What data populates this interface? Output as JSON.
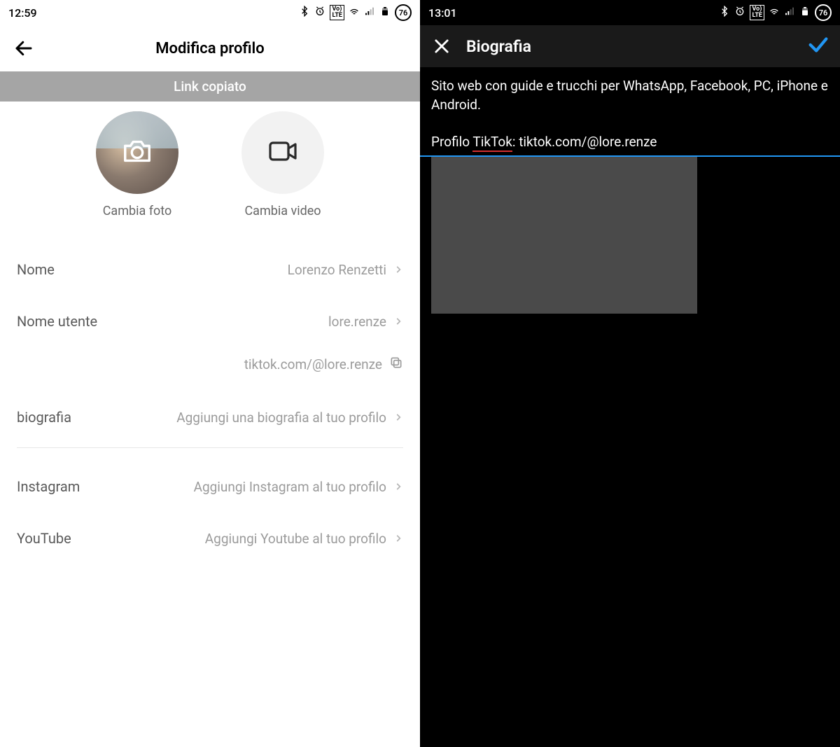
{
  "left": {
    "status": {
      "time": "12:59",
      "battery": "76"
    },
    "appbar": {
      "title": "Modifica profilo"
    },
    "toast": "Link copiato",
    "media": {
      "photo_label": "Cambia foto",
      "video_label": "Cambia video"
    },
    "fields": {
      "name_label": "Nome",
      "name_value": "Lorenzo Renzetti",
      "username_label": "Nome utente",
      "username_value": "lore.renze",
      "profile_link": "tiktok.com/@lore.renze",
      "bio_label": "biografia",
      "bio_placeholder": "Aggiungi una biografia al tuo profilo",
      "instagram_label": "Instagram",
      "instagram_placeholder": "Aggiungi Instagram al tuo profilo",
      "youtube_label": "YouTube",
      "youtube_placeholder": "Aggiungi Youtube al tuo profilo"
    }
  },
  "right": {
    "status": {
      "time": "13:01",
      "battery": "76"
    },
    "appbar": {
      "title": "Biografia"
    },
    "bio": {
      "line1": "Sito web con guide e trucchi per WhatsApp, Facebook, PC, iPhone e Android.",
      "line2_pre": "Profilo ",
      "line2_err": "TikTok",
      "line2_post": ": tiktok.com/@lore.renze"
    }
  }
}
